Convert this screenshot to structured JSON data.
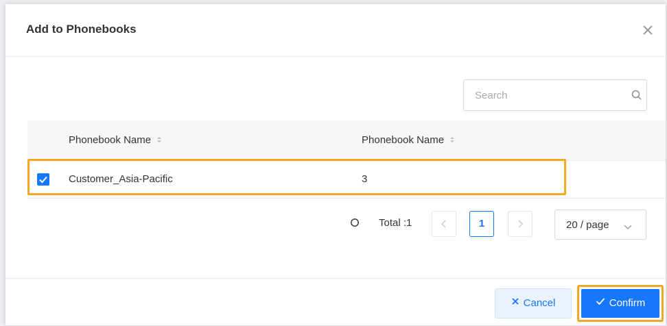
{
  "dialog": {
    "title": "Add to Phonebooks"
  },
  "search": {
    "placeholder": "Search"
  },
  "table": {
    "columns": [
      "Phonebook Name",
      "Phonebook Name"
    ],
    "rows": [
      {
        "selected": true,
        "name": "Customer_Asia-Pacific",
        "value": "3"
      }
    ]
  },
  "pagination": {
    "total_label": "Total :1",
    "prev_icon": "chevron-left",
    "current_page": "1",
    "next_icon": "chevron-right",
    "page_size": "20 / page"
  },
  "footer": {
    "cancel_label": "Cancel",
    "confirm_label": "Confirm"
  },
  "colors": {
    "primary": "#1677ff",
    "highlight": "#f5a623"
  },
  "icons": [
    "close-icon",
    "search-icon",
    "sort-icon",
    "checkbox-checked-icon",
    "loading-icon",
    "chevron-left-icon",
    "chevron-right-icon",
    "chevron-down-icon",
    "x-icon",
    "check-icon"
  ]
}
